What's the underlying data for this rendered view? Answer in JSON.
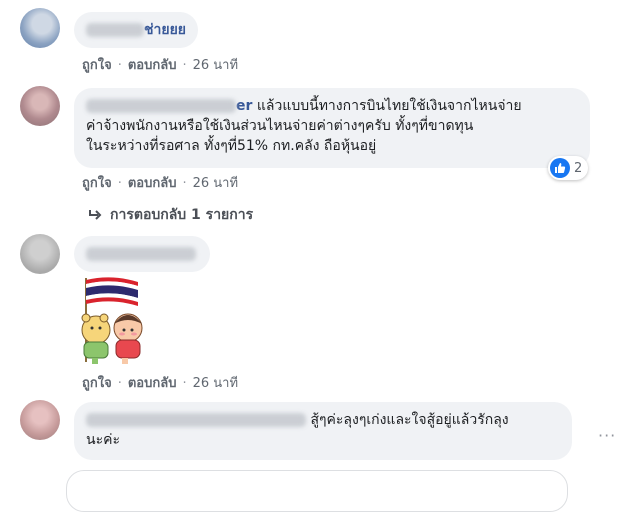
{
  "comments": [
    {
      "name_tail": "ช่ายยย",
      "text": "",
      "actions": {
        "like": "ถูกใจ",
        "reply": "ตอบกลับ",
        "time": "26 นาที"
      }
    },
    {
      "name_tail": "er",
      "text_lines": [
        "แล้วแบบนี้ทางการบินไทยใช้เงินจากไหนจ่าย",
        "ค่าจ้างพนักงานหรือใช้เงินส่วนไหนจ่ายค่าต่างๆครับ ทั้งๆที่ขาดทุน",
        "ในระหว่างที่รอศาล ทั้งๆที่51% กท.คลัง ถือหุ้นอยู่"
      ],
      "reaction_count": "2",
      "actions": {
        "like": "ถูกใจ",
        "reply": "ตอบกลับ",
        "time": "26 นาที"
      },
      "replies_label": "การตอบกลับ 1 รายการ"
    },
    {
      "name_tail": "",
      "sticker": "thai-flag-bears-sticker",
      "actions": {
        "like": "ถูกใจ",
        "reply": "ตอบกลับ",
        "time": "26 นาที"
      }
    },
    {
      "name_tail": "",
      "text_lines": [
        "สู้ๆค่ะลุงๆเก่งและใจสู้อยู่แล้วรักลุง",
        "นะค่ะ"
      ]
    }
  ],
  "more_label": "···",
  "colors": {
    "like_blue": "#1877f2",
    "bubble_bg": "#f0f2f5"
  }
}
